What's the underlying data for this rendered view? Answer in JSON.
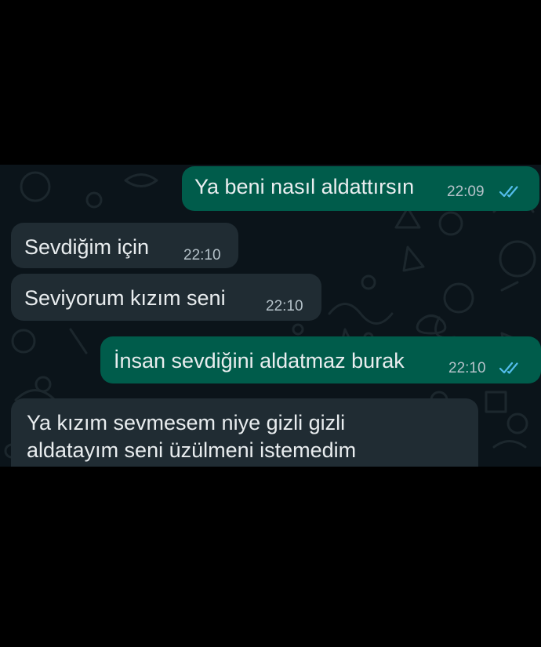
{
  "chat": {
    "messages": [
      {
        "direction": "outgoing",
        "text": "Ya beni nasıl aldattırsın",
        "time": "22:09",
        "status_icon": "double-check-read-icon"
      },
      {
        "direction": "incoming",
        "text": "Sevdiğim için",
        "time": "22:10"
      },
      {
        "direction": "incoming",
        "text": "Seviyorum kızım seni",
        "time": "22:10"
      },
      {
        "direction": "outgoing",
        "text": "İnsan sevdiğini aldatmaz burak",
        "time": "22:10",
        "status_icon": "double-check-read-icon"
      },
      {
        "direction": "incoming",
        "text_lines": [
          "Ya kızım sevmesem niye gizli gizli",
          "aldatayım seni üzülmeni istemedim"
        ]
      }
    ]
  },
  "colors": {
    "outgoing_bubble": "#005c4b",
    "incoming_bubble": "#202c33",
    "chat_background": "#0b141a",
    "read_ticks": "#53bdeb"
  }
}
